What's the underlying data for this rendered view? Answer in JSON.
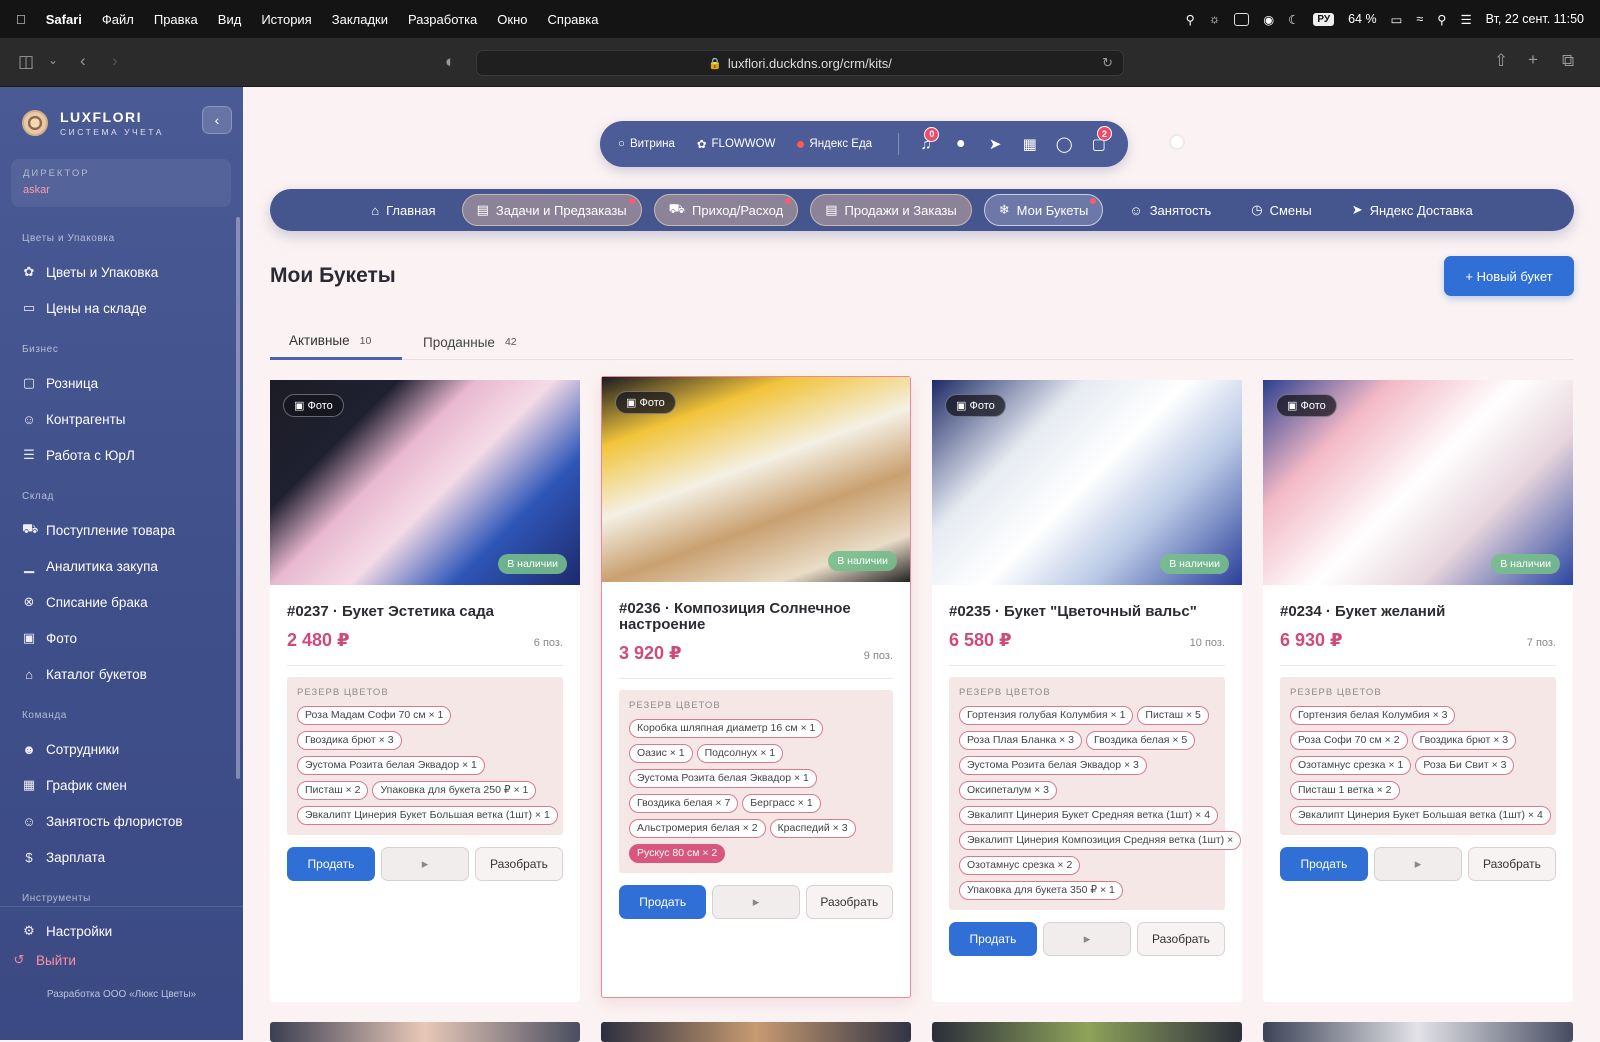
{
  "menubar": {
    "app": "Safari",
    "items": [
      "Файл",
      "Правка",
      "Вид",
      "История",
      "Закладки",
      "Разработка",
      "Окно",
      "Справка"
    ],
    "battery": "64 %",
    "input_lang": "РУ",
    "datetime": "Вт, 22 сент.  11:50"
  },
  "browser": {
    "url": "luxflori.duckdns.org/crm/kits/"
  },
  "sidebar": {
    "brand_name": "LUXFLORI",
    "brand_sub": "СИСТЕМА УЧЕТА",
    "role_label": "ДИРЕКТОР",
    "user": "askar",
    "sections": [
      {
        "title": "Цветы и Упаковка",
        "items": [
          {
            "label": "Цветы и Упаковка",
            "icon": "flower-icon"
          },
          {
            "label": "Цены на складе",
            "icon": "monitor-icon"
          }
        ]
      },
      {
        "title": "Бизнес",
        "items": [
          {
            "label": "Розница",
            "icon": "bag-icon"
          },
          {
            "label": "Контрагенты",
            "icon": "users-icon"
          },
          {
            "label": "Работа с ЮрЛ",
            "icon": "document-icon"
          }
        ]
      },
      {
        "title": "Склад",
        "items": [
          {
            "label": "Поступление товара",
            "icon": "truck-icon"
          },
          {
            "label": "Аналитика закупа",
            "icon": "chart-icon"
          },
          {
            "label": "Списание брака",
            "icon": "x-circle-icon"
          },
          {
            "label": "Фото",
            "icon": "image-icon"
          },
          {
            "label": "Каталог букетов",
            "icon": "shield-icon"
          }
        ]
      },
      {
        "title": "Команда",
        "items": [
          {
            "label": "Сотрудники",
            "icon": "user-icon"
          },
          {
            "label": "График смен",
            "icon": "calendar-icon"
          },
          {
            "label": "Занятость флористов",
            "icon": "users-icon"
          },
          {
            "label": "Зарплата",
            "icon": "dollar-icon"
          }
        ]
      },
      {
        "title": "Инструменты",
        "items": []
      }
    ],
    "settings": "Настройки",
    "logout": "Выйти",
    "dev": "Разработка ООО «Люкс Цветы»"
  },
  "topbar": {
    "links": [
      {
        "label": "Витрина",
        "icon": "globe-icon"
      },
      {
        "label": "FLOWWOW",
        "icon": "flower-icon"
      },
      {
        "label": "Яндекс Еда",
        "icon": "yandex-icon"
      }
    ],
    "notifications": "0",
    "cart": "2"
  },
  "mainnav": [
    {
      "label": "Главная",
      "icon": "home-icon",
      "style": "plain",
      "dot": false
    },
    {
      "label": "Задачи и Предзаказы",
      "icon": "clipboard-icon",
      "style": "hl",
      "dot": true
    },
    {
      "label": "Приход/Расход",
      "icon": "truck-icon",
      "style": "hl",
      "dot": true
    },
    {
      "label": "Продажи и Заказы",
      "icon": "clipboard-icon",
      "style": "hl",
      "dot": false
    },
    {
      "label": "Мои Букеты",
      "icon": "gift-icon",
      "style": "active",
      "dot": true
    },
    {
      "label": "Занятость",
      "icon": "users-icon",
      "style": "plain",
      "dot": false
    },
    {
      "label": "Смены",
      "icon": "clock-icon",
      "style": "plain",
      "dot": false
    },
    {
      "label": "Яндекс Доставка",
      "icon": "send-icon",
      "style": "plain",
      "dot": false
    }
  ],
  "page": {
    "title": "Мои Букеты",
    "new_button": "+ Новый букет",
    "tabs": [
      {
        "label": "Активные",
        "count": "10"
      },
      {
        "label": "Проданные",
        "count": "42"
      }
    ],
    "labels": {
      "photo": "Фото",
      "stock": "В наличии",
      "reserve": "РЕЗЕРВ ЦВЕТОВ",
      "sell": "Продать",
      "disassemble": "Разобрать"
    }
  },
  "colors": {
    "accent": "#2f6fd6",
    "price": "#cf4a7b",
    "sidebar": "#45568f",
    "chip_border": "#d9798f"
  },
  "cards": [
    {
      "title": "#0237 · Букет Эстетика сада",
      "price": "2 480 ₽",
      "positions": "6 поз.",
      "chips": [
        "Роза Мадам Софи 70 см × 1",
        "Гвоздика брют × 3",
        "Эустома Розита белая Эквадор × 1",
        "Писташ × 2",
        "Упаковка для букета 250 ₽ × 1",
        "Эвкалипт Цинерия Букет Большая ветка (1шт) × 1"
      ],
      "pink": []
    },
    {
      "title": "#0236 · Композиция Солнечное настроение",
      "price": "3 920 ₽",
      "positions": "9 поз.",
      "chips": [
        "Коробка шляпная диаметр 16 см × 1",
        "Оазис × 1",
        "Подсолнух × 1",
        "Эустома Розита белая Эквадор × 1",
        "Гвоздика белая × 7",
        "Берграсс × 1",
        "Альстромерия белая × 2",
        "Краспедий × 3"
      ],
      "pink": [
        "Рускус 80 см × 2"
      ]
    },
    {
      "title": "#0235 · Букет \"Цветочный вальс\"",
      "price": "6 580 ₽",
      "positions": "10 поз.",
      "chips": [
        "Гортензия голубая Колумбия × 1",
        "Писташ × 5",
        "Роза Плая Бланка × 3",
        "Гвоздика белая × 5",
        "Эустома Розита белая Эквадор × 3",
        "Оксипеталум × 3",
        "Эвкалипт Цинерия Букет Средняя ветка (1шт) × 4",
        "Эвкалипт Цинерия Композиция Средняя ветка (1шт) ×",
        "Озотамнус срезка × 2",
        "Упаковка для букета 350 ₽ × 1"
      ],
      "pink": []
    },
    {
      "title": "#0234 · Букет желаний",
      "price": "6 930 ₽",
      "positions": "7 поз.",
      "chips": [
        "Гортензия белая Колумбия × 3",
        "Роза Софи 70 см × 2",
        "Гвоздика брют × 3",
        "Озотамнус срезка × 1",
        "Роза Би Свит × 3",
        "Писташ 1 ветка × 2",
        "Эвкалипт Цинерия Букет Большая ветка (1шт) × 4"
      ],
      "pink": []
    }
  ]
}
